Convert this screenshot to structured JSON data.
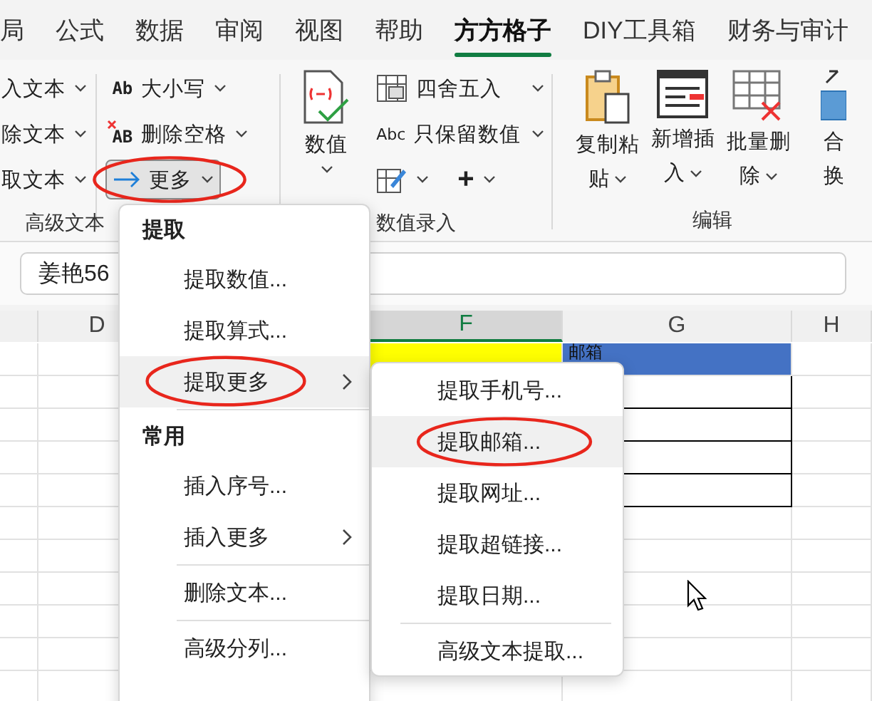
{
  "tabs": [
    {
      "label": "局",
      "selected": false
    },
    {
      "label": "公式",
      "selected": false
    },
    {
      "label": "数据",
      "selected": false
    },
    {
      "label": "审阅",
      "selected": false
    },
    {
      "label": "视图",
      "selected": false
    },
    {
      "label": "帮助",
      "selected": false
    },
    {
      "label": "方方格子",
      "selected": true
    },
    {
      "label": "DIY工具箱",
      "selected": false
    },
    {
      "label": "财务与审计",
      "selected": false
    }
  ],
  "ribbon": {
    "text_commands": [
      {
        "label": "入文本"
      },
      {
        "label": "除文本"
      },
      {
        "label": "取文本"
      }
    ],
    "case_commands": [
      {
        "kind": "case",
        "icon_text": "Ab",
        "label": "大小写",
        "selected": false,
        "circled": false
      },
      {
        "kind": "trim",
        "icon_text": "AB",
        "label": "删除空格",
        "selected": false,
        "circled": false
      },
      {
        "kind": "more",
        "label": "更多",
        "selected": true,
        "circled": true
      }
    ],
    "text_group_label": "高级文本",
    "value_button": "数值",
    "number_commands": [
      {
        "kind": "round",
        "label": "四舍五入"
      },
      {
        "kind": "keep",
        "icon_text": "Abc",
        "label": "只保留数值"
      }
    ],
    "number_tools": [
      {
        "kind": "edit"
      },
      {
        "kind": "plus",
        "label": "+"
      }
    ],
    "number_group_label": "数值录入",
    "edit_buttons": [
      {
        "kind": "paste",
        "lines": [
          "复制粘",
          "贴"
        ],
        "caret": true
      },
      {
        "kind": "insert",
        "lines": [
          "新增插",
          "入"
        ],
        "caret": true
      },
      {
        "kind": "delete",
        "lines": [
          "批量删",
          "除"
        ],
        "caret": true
      },
      {
        "kind": "convert",
        "lines": [
          "合",
          "换"
        ],
        "caret": false
      }
    ],
    "edit_group_label": "编辑"
  },
  "formula_bar": {
    "value": "姜艳56"
  },
  "columns": [
    {
      "label": "D",
      "selected": false
    },
    {
      "label": "F",
      "selected": true
    },
    {
      "label": "G",
      "selected": false
    },
    {
      "label": "H",
      "selected": false
    }
  ],
  "header_cell": "邮箱",
  "menu": {
    "items": [
      {
        "kind": "header",
        "label": "提取"
      },
      {
        "kind": "item",
        "label": "提取数值...",
        "selected": false,
        "circled": false
      },
      {
        "kind": "item",
        "label": "提取算式...",
        "selected": false,
        "circled": false
      },
      {
        "kind": "submenu",
        "label": "提取更多",
        "selected": true,
        "circled": true
      },
      {
        "kind": "separator"
      },
      {
        "kind": "header",
        "label": "常用"
      },
      {
        "kind": "item",
        "label": "插入序号...",
        "selected": false,
        "circled": false
      },
      {
        "kind": "submenu",
        "label": "插入更多",
        "selected": false,
        "circled": false
      },
      {
        "kind": "separator"
      },
      {
        "kind": "item",
        "label": "删除文本...",
        "selected": false,
        "circled": false
      },
      {
        "kind": "separator"
      },
      {
        "kind": "item",
        "label": "高级分列...",
        "selected": false,
        "circled": false
      }
    ]
  },
  "submenu": {
    "items": [
      {
        "kind": "item",
        "label": "提取手机号...",
        "selected": false,
        "circled": false
      },
      {
        "kind": "item",
        "label": "提取邮箱...",
        "selected": true,
        "circled": true
      },
      {
        "kind": "item",
        "label": "提取网址...",
        "selected": false,
        "circled": false
      },
      {
        "kind": "item",
        "label": "提取超链接...",
        "selected": false,
        "circled": false
      },
      {
        "kind": "item",
        "label": "提取日期...",
        "selected": false,
        "circled": false
      },
      {
        "kind": "separator"
      },
      {
        "kind": "item",
        "label": "高级文本提取...",
        "selected": false,
        "circled": false
      }
    ]
  }
}
